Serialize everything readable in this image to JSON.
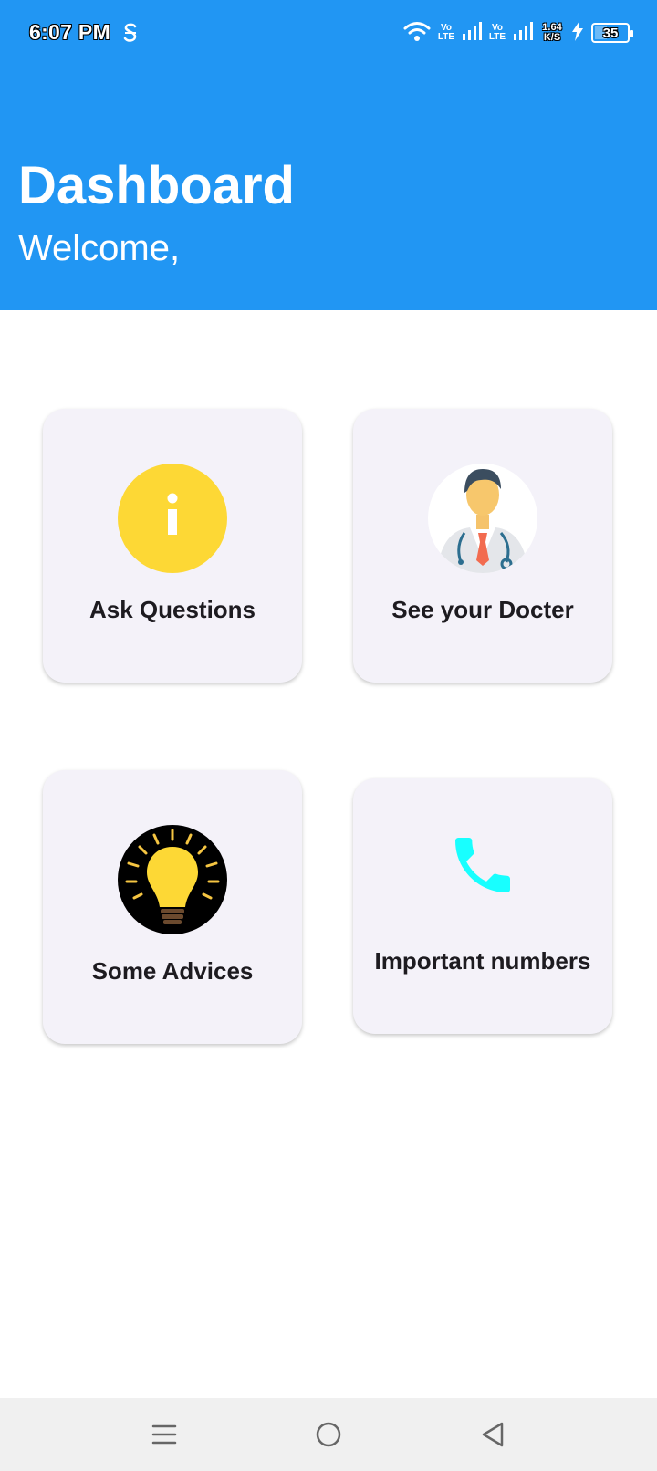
{
  "status_bar": {
    "time": "6:07 PM",
    "sim1_label": "Vo\nLTE",
    "sim2_label": "Vo\nLTE",
    "speed_value": "1.64",
    "speed_unit": "K/S",
    "battery_level": "35"
  },
  "header": {
    "title": "Dashboard",
    "subtitle": "Welcome,"
  },
  "cards": [
    {
      "label": "Ask Questions",
      "icon": "info-icon"
    },
    {
      "label": "See your Docter",
      "icon": "doctor-icon"
    },
    {
      "label": "Some Advices",
      "icon": "lightbulb-icon"
    },
    {
      "label": "Important numbers",
      "icon": "phone-icon"
    }
  ],
  "colors": {
    "header": "#2196F3",
    "card_bg": "#f4f2f9",
    "info_circle": "#FDD835",
    "phone": "#18FFFF"
  },
  "nav_bar": {
    "items": [
      "menu-icon",
      "home-icon",
      "back-icon"
    ]
  }
}
